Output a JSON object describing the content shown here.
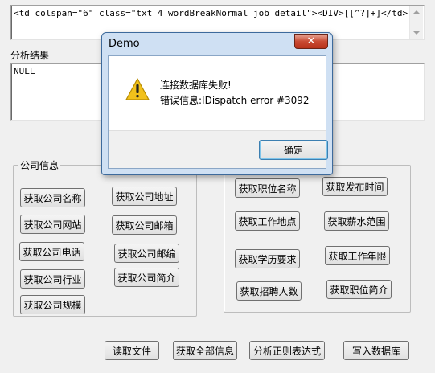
{
  "regex_input": {
    "value": "<td colspan=\"6\" class=\"txt_4 wordBreakNormal job_detail\"><DIV>[[^?]+]</td>"
  },
  "result_label": "分析结果",
  "result_box": {
    "value": "NULL"
  },
  "company_group": {
    "title": "公司信息",
    "buttons": [
      "获取公司名称",
      "获取公司地址",
      "获取公司网站",
      "获取公司邮箱",
      "获取公司电话",
      "获取公司邮编",
      "获取公司行业",
      "获取公司简介",
      "获取公司规模"
    ]
  },
  "job_group": {
    "buttons": [
      "获取职位名称",
      "获取发布时间",
      "获取工作地点",
      "获取薪水范围",
      "获取学历要求",
      "获取工作年限",
      "获取招聘人数",
      "获取职位简介"
    ]
  },
  "bottom_buttons": [
    "读取文件",
    "获取全部信息",
    "分析正则表达式",
    "写入数据库"
  ],
  "dialog": {
    "title": "Demo",
    "close_glyph": "✕",
    "message_line1": "连接数据库失败!",
    "message_line2": "错误信息:IDispatch error #3092",
    "ok_label": "确定",
    "icon": "warning-icon"
  },
  "colors": {
    "dialog_frame": "#cfe0f3",
    "close_button": "#c94a33",
    "warning": "#f2c11b"
  }
}
